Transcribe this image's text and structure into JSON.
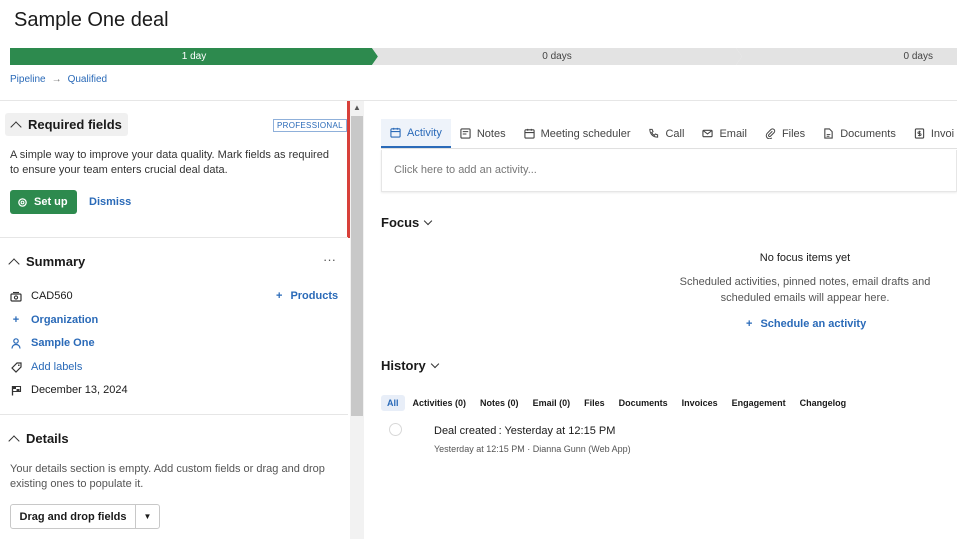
{
  "deal": {
    "title": "Sample One deal"
  },
  "stages": [
    "1 day",
    "0 days",
    "0 days"
  ],
  "breadcrumb": [
    "Pipeline",
    "Qualified"
  ],
  "required_fields": {
    "title": "Required fields",
    "badge": "PROFESSIONAL",
    "description": "A simple way to improve your data quality. Mark fields as required to ensure your team enters crucial deal data.",
    "setup_label": "Set up",
    "dismiss_label": "Dismiss"
  },
  "summary": {
    "title": "Summary",
    "more": "···",
    "value": "CAD560",
    "products_label": "Products",
    "organization_label": "Organization",
    "person": "Sample One",
    "labels_label": "Add labels",
    "close_date": "December 13, 2024"
  },
  "details": {
    "title": "Details",
    "description": "Your details section is empty. Add custom fields or drag and drop existing ones to populate it.",
    "drag_label": "Drag and drop fields"
  },
  "tabs": [
    "Activity",
    "Notes",
    "Meeting scheduler",
    "Call",
    "Email",
    "Files",
    "Documents",
    "Invoi"
  ],
  "activity_placeholder": "Click here to add an activity...",
  "focus": {
    "title": "Focus",
    "empty_title": "No focus items yet",
    "empty_text": "Scheduled activities, pinned notes, email drafts and scheduled emails will appear here.",
    "schedule_label": "Schedule an activity"
  },
  "history": {
    "title": "History",
    "filters": [
      "All",
      "Activities (0)",
      "Notes (0)",
      "Email (0)",
      "Files",
      "Documents",
      "Invoices",
      "Engagement",
      "Changelog"
    ],
    "item_title": "Deal created : Yesterday at 12:15 PM",
    "item_meta": "Yesterday at 12:15 PM · Dianna Gunn (Web App)"
  },
  "colors": {
    "accent": "#2a6ab8",
    "success": "#2d8a4e",
    "alert": "#d8403a"
  },
  "icons": [
    "calendar-icon",
    "note-icon",
    "meeting-icon",
    "phone-icon",
    "email-icon",
    "paperclip-icon",
    "document-icon",
    "invoice-icon"
  ]
}
